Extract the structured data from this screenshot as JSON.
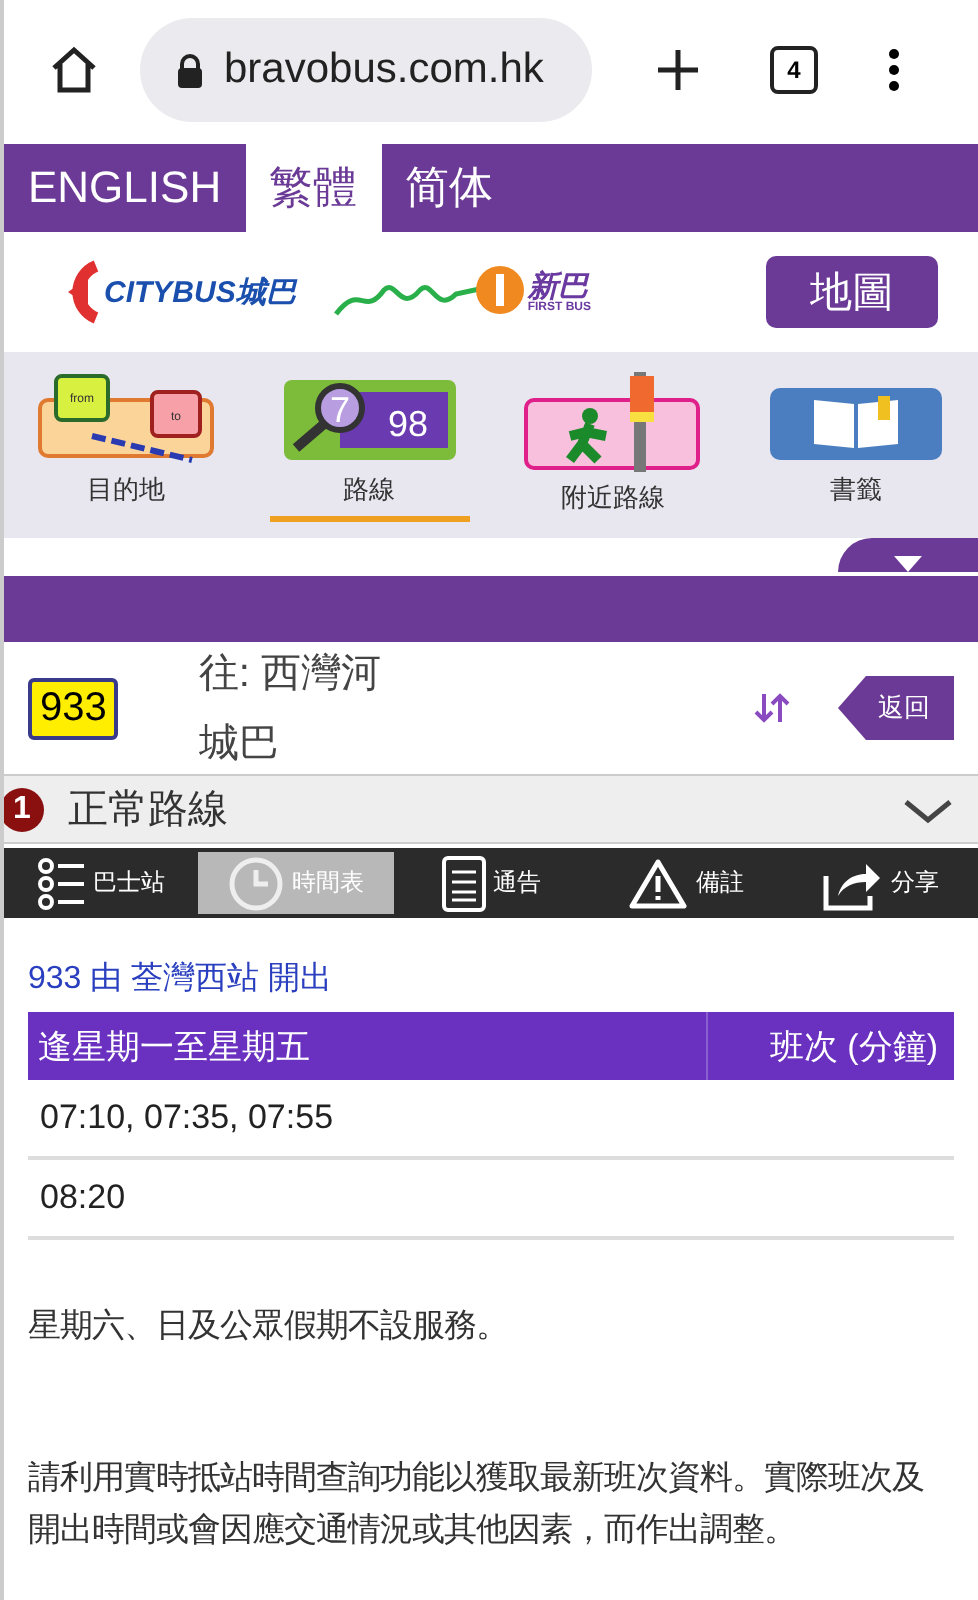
{
  "browser": {
    "url": "bravobus.com.hk",
    "tab_count": "4"
  },
  "languages": [
    {
      "label": "ENGLISH",
      "selected": false
    },
    {
      "label": "繁體",
      "selected": true
    },
    {
      "label": "简体",
      "selected": false
    }
  ],
  "logos": {
    "citybus": "CITYBUS城巴",
    "firstbus": "新巴",
    "firstbus_sub": "FIRST BUS"
  },
  "map_button": "地圖",
  "nav": [
    {
      "kind": "destination",
      "label": "目的地",
      "selected": false,
      "icon_texts": [
        "from",
        "to"
      ]
    },
    {
      "kind": "route",
      "label": "路線",
      "selected": true,
      "icon_texts": [
        "7",
        "98"
      ]
    },
    {
      "kind": "nearby",
      "label": "附近路線",
      "selected": false
    },
    {
      "kind": "bookmark",
      "label": "書籤",
      "selected": false
    }
  ],
  "route": {
    "number": "933",
    "destination": "往: 西灣河",
    "operator": "城巴",
    "back": "返回"
  },
  "variant": {
    "index": "1",
    "name": "正常路線",
    "expanded": false
  },
  "tabs": [
    {
      "kind": "stops",
      "label": "巴士站",
      "selected": false
    },
    {
      "kind": "timetable",
      "label": "時間表",
      "selected": true
    },
    {
      "kind": "notice",
      "label": "通告",
      "selected": false
    },
    {
      "kind": "remarks",
      "label": "備註",
      "selected": false
    },
    {
      "kind": "share",
      "label": "分享",
      "selected": false
    }
  ],
  "timetable": {
    "title": "933 由 荃灣西站 開出",
    "columns": [
      "逢星期一至星期五",
      "班次 (分鐘)"
    ],
    "rows": [
      "07:10, 07:35, 07:55",
      "08:20"
    ]
  },
  "notes": [
    "星期六、日及公眾假期不設服務。",
    "請利用實時抵站時間查詢功能以獲取最新班次資料。實際班次及開出時間或會因應交通情況或其他因素，而作出調整。"
  ]
}
